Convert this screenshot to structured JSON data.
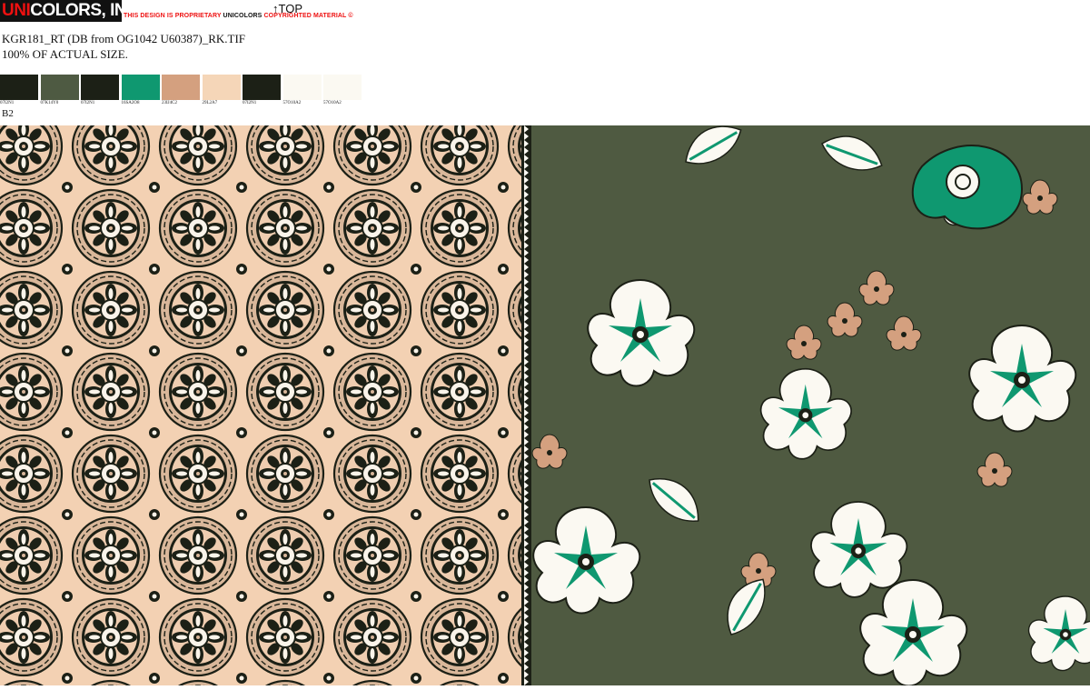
{
  "header": {
    "logo_prefix": "UNI",
    "logo_rest": "COLORS, INC.",
    "notice_part1": "THIS DESIGN IS PROPRIETARY ",
    "notice_brand": "UNICOLORS",
    "notice_part2": " COPYRIGHTED MATERIAL ©",
    "top_label": "↑TOP",
    "filename": "KGR181_RT (DB from OG1042 U60387)_RK.TIF",
    "scale": "100% OF ACTUAL SIZE.",
    "variant": "B2"
  },
  "swatches": [
    {
      "code": "07I2N1",
      "color": "#1c2016"
    },
    {
      "code": "07K14Y0",
      "color": "#4e5a42"
    },
    {
      "code": "07I2N1",
      "color": "#1c2016"
    },
    {
      "code": "16SA2O8",
      "color": "#0f9870"
    },
    {
      "code": "23IJ4C2",
      "color": "#d4a07f"
    },
    {
      "code": "29L2A7",
      "color": "#f5d6b8"
    },
    {
      "code": "07I2N1",
      "color": "#1c2016"
    },
    {
      "code": "57O10A2",
      "color": "#fbf9f2"
    },
    {
      "code": "57O10A2",
      "color": "#fbf9f2"
    }
  ],
  "palette": {
    "dark": "#1c2016",
    "olive": "#4f5a41",
    "green": "#0f9870",
    "tan": "#d4a07f",
    "peach": "#f5d6b8",
    "cream": "#fbf9f2"
  }
}
